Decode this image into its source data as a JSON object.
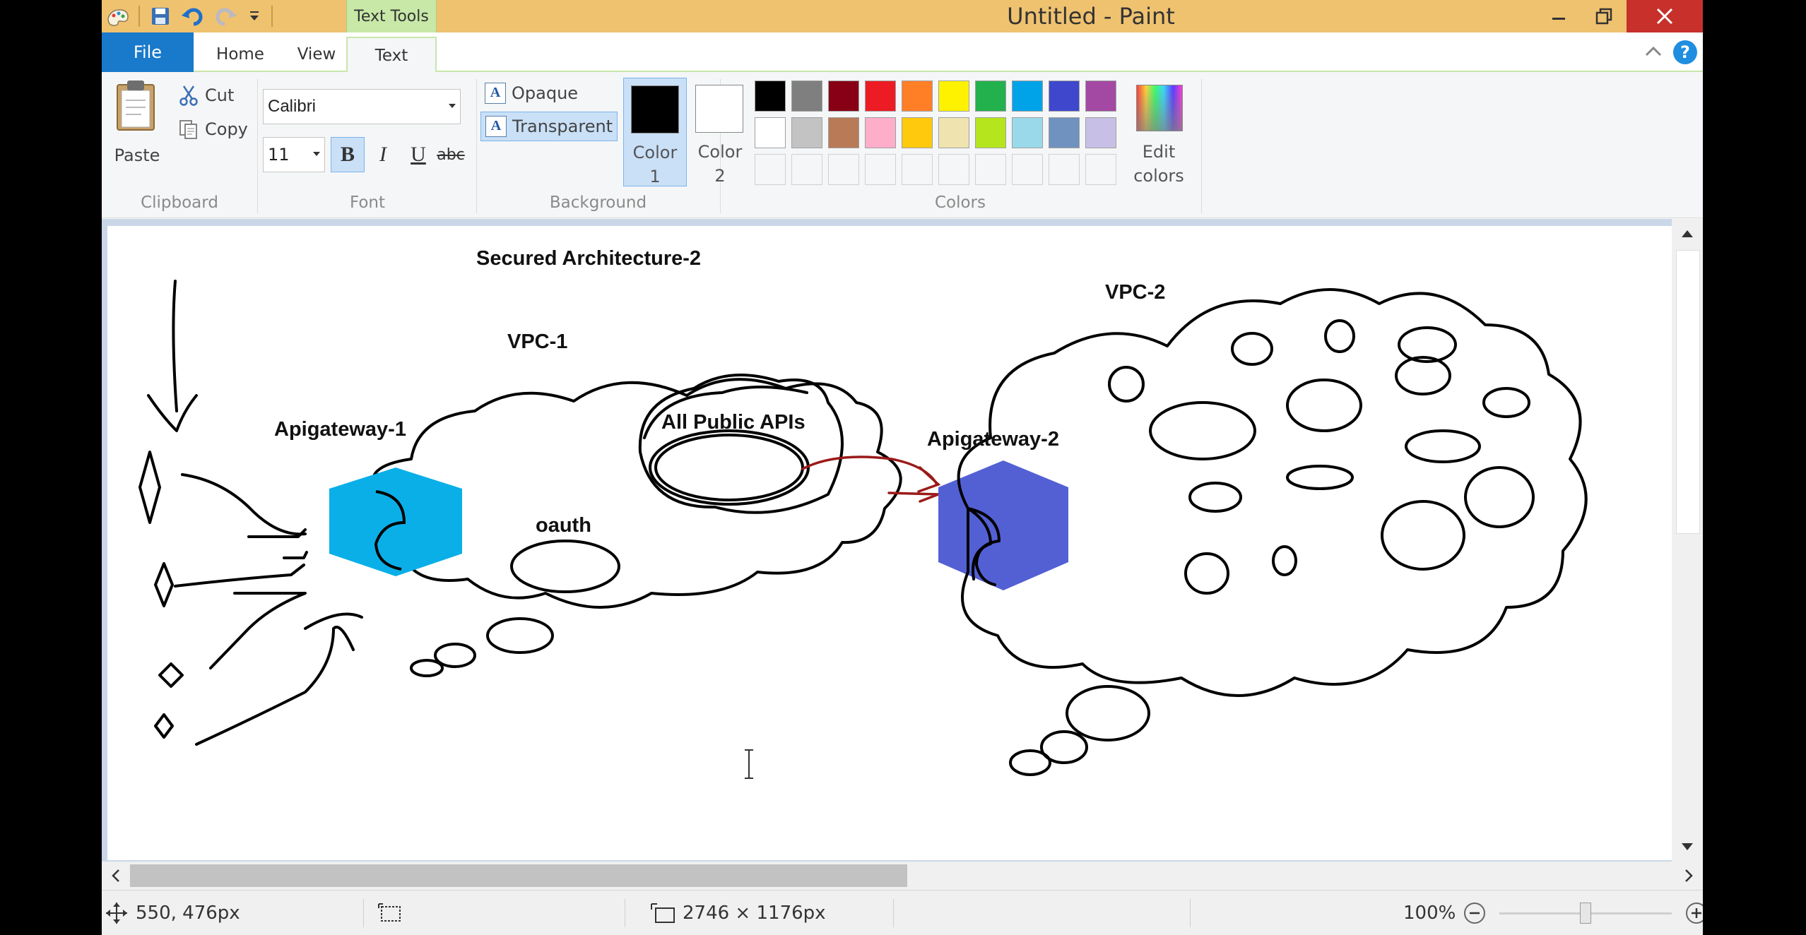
{
  "window": {
    "title": "Untitled - Paint",
    "context_tab": "Text Tools"
  },
  "tabs": {
    "file": "File",
    "items": [
      {
        "label": "Home",
        "active": false
      },
      {
        "label": "View",
        "active": false
      },
      {
        "label": "Text",
        "active": true
      }
    ]
  },
  "ribbon": {
    "clipboard": {
      "paste": "Paste",
      "cut": "Cut",
      "copy": "Copy",
      "group": "Clipboard"
    },
    "font": {
      "family": "Calibri",
      "size": "11",
      "bold": "B",
      "italic": "I",
      "underline": "U",
      "strike": "abc",
      "group": "Font"
    },
    "background": {
      "opaque": "Opaque",
      "transparent": "Transparent",
      "group": "Background"
    },
    "colors": {
      "color1_line1": "Color",
      "color1_line2": "1",
      "color2_line1": "Color",
      "color2_line2": "2",
      "color1": "#000000",
      "color2": "#ffffff",
      "edit_line1": "Edit",
      "edit_line2": "colors",
      "group": "Colors",
      "palette_row1": [
        "#000000",
        "#7f7f7f",
        "#880015",
        "#ed1c24",
        "#ff7f27",
        "#fff200",
        "#22b14c",
        "#00a2e8",
        "#3f48cc",
        "#a349a4"
      ],
      "palette_row2": [
        "#ffffff",
        "#c3c3c3",
        "#b97a57",
        "#ffaec9",
        "#ffc90e",
        "#efe4b0",
        "#b5e61d",
        "#99d9ea",
        "#7092be",
        "#c8bfe7"
      ]
    }
  },
  "drawing": {
    "title": "Secured Architecture-2",
    "vpc1": "VPC-1",
    "vpc2": "VPC-2",
    "gateway1": "Apigateway-1",
    "gateway2": "Apigateway-2",
    "public_apis": "All Public APIs",
    "oauth": "oauth",
    "gateway1_color": "#0aafe8",
    "gateway2_color": "#5360d4",
    "arrow_color": "#9b1a1a"
  },
  "status": {
    "cursor_pos": "550, 476px",
    "canvas_size": "2746 × 1176px",
    "zoom": "100%",
    "zoom_fraction": 0.5
  }
}
